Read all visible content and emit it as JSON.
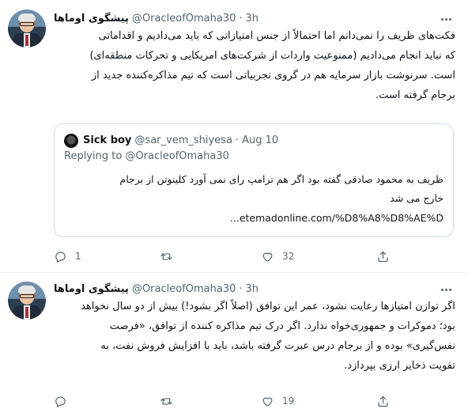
{
  "tweets": [
    {
      "display_name": "پیشگوی اوماها",
      "handle": "@OracleofOmaha30",
      "separator": "·",
      "time": "3h",
      "text_lines": [
        "فکت‌های ظریف را نمی‌دانم اما احتمالاً از جنس امتیازاتی که باید می‌دادیم و اقداماتی",
        "که نباید انجام می‌دادیم (ممنوعیت واردات از شرکت‌های امریکایی و تحرکات منطقه‌ای)",
        "است. سرنوشت بازار سرمایه هم در گروی تجربیاتی است که تیم مذاکره‌کننده جدید از",
        "برجام گرفته است."
      ],
      "quote": {
        "display_name": "Sick boy",
        "handle": "@sar_vem_shiyesa",
        "separator": "·",
        "date": "Aug 10",
        "replying_to_label": "Replying to",
        "replying_to_handle": "@OracleofOmaha30",
        "text_lines": [
          "ظریف به محمود صادقی گفته بود اگر هم ترامپ رای نمی آورد کلینوتن از برجام",
          "خارج می شد"
        ],
        "link": "etemadonline.com/%D8%A8%D8%AE%D..."
      },
      "actions": {
        "reply_count": "1",
        "retweet_count": "",
        "like_count": "32"
      }
    },
    {
      "display_name": "پیشگوی اوماها",
      "handle": "@OracleofOmaha30",
      "separator": "·",
      "time": "3h",
      "text_lines": [
        "اگر توازن امتیازها رعایت نشود، عمر این توافق (اصلاً اگر بشود!) بیش از دو سال نخواهد",
        "بود؛ دموکرات و جمهوری‌خواه ندارد. اگر درک تیم مذاکره کننده از توافق، «فرصت",
        "نفس‌گیری» بوده و از برجام درس عبرت گرفته باشد، باید با افزایش فروش نفت، به",
        "تقویت ذخایر ارزی بپردازد."
      ],
      "actions": {
        "reply_count": "",
        "retweet_count": "",
        "like_count": "19"
      }
    }
  ],
  "icons": {
    "more": "more-icon",
    "reply": "reply-icon",
    "retweet": "retweet-icon",
    "like": "heart-icon",
    "share": "share-icon"
  },
  "colors": {
    "text_primary": "#0f1419",
    "text_secondary": "#536471",
    "border": "#cfd9de",
    "divider": "#eff3f4"
  }
}
